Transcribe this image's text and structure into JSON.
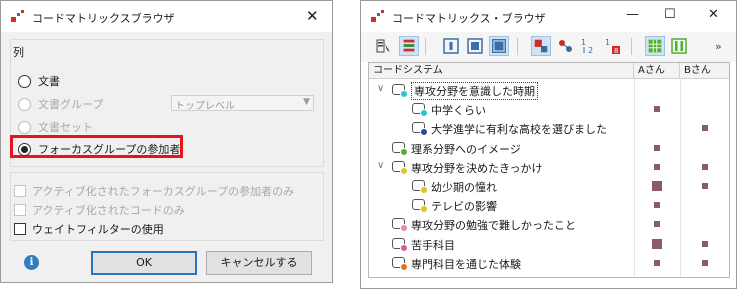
{
  "dialog": {
    "title": "コードマトリックスブラウザ",
    "close_glyph": "✕",
    "group_label": "列",
    "radios": [
      {
        "label": "文書",
        "selected": false,
        "enabled": true
      },
      {
        "label": "文書グループ",
        "selected": false,
        "enabled": false
      },
      {
        "label": "文書セット",
        "selected": false,
        "enabled": false
      },
      {
        "label": "フォーカスグループの参加者",
        "selected": true,
        "enabled": true
      }
    ],
    "group_combo_value": "トップレベル",
    "checkboxes": [
      {
        "label": "アクティブ化されたフォーカスグループの参加者のみ",
        "checked": false,
        "enabled": false
      },
      {
        "label": "アクティブ化されたコードのみ",
        "checked": false,
        "enabled": false
      },
      {
        "label": "ウェイトフィルターの使用",
        "checked": false,
        "enabled": true
      }
    ],
    "info_glyph": "i",
    "ok_label": "OK",
    "cancel_label": "キャンセルする",
    "highlight_color": "#e8141a"
  },
  "browser": {
    "title": "コードマトリックス・ブラウザ",
    "window_controls": {
      "minimize": "—",
      "maximize": "☐",
      "close": "✕"
    },
    "toolbar_more": "»",
    "toolbar_icons": [
      "code-list-icon",
      "doc-list-icon",
      "column-view-icon",
      "square-view-icon",
      "filled-square-icon",
      "node-icon",
      "node-link-icon",
      "sort-one-two-icon",
      "sort-one-eight-icon",
      "grid-icon",
      "columns-icon"
    ],
    "columns": [
      "コードシステム",
      "Aさん",
      "Bさん"
    ],
    "rows": [
      {
        "label": "専攻分野を意識した時期",
        "level": 0,
        "expander": "∨",
        "color": "#2ac4d6",
        "focused": true,
        "a": 0,
        "b": 0
      },
      {
        "label": "中学くらい",
        "level": 1,
        "expander": "",
        "color": "#2ac4d6",
        "focused": false,
        "a": 1,
        "b": 0
      },
      {
        "label": "大学進学に有利な高校を選びました",
        "level": 1,
        "expander": "",
        "color": "#1e4ea0",
        "focused": false,
        "a": 0,
        "b": 1
      },
      {
        "label": "理系分野へのイメージ",
        "level": 0,
        "expander": "",
        "color": "#4eb030",
        "focused": false,
        "a": 1,
        "b": 0
      },
      {
        "label": "専攻分野を決めたきっかけ",
        "level": 0,
        "expander": "∨",
        "color": "#e0c51c",
        "focused": false,
        "a": 1,
        "b": 1
      },
      {
        "label": "幼少期の憧れ",
        "level": 1,
        "expander": "",
        "color": "#e0c51c",
        "focused": false,
        "a": 2,
        "b": 1
      },
      {
        "label": "テレビの影響",
        "level": 1,
        "expander": "",
        "color": "#e0c51c",
        "focused": false,
        "a": 1,
        "b": 0
      },
      {
        "label": "専攻分野の勉強で難しかったこと",
        "level": 0,
        "expander": "",
        "color": "#e889b4",
        "focused": false,
        "a": 1,
        "b": 0
      },
      {
        "label": "苦手科目",
        "level": 0,
        "expander": "",
        "color": "#e0579c",
        "focused": false,
        "a": 2,
        "b": 1
      },
      {
        "label": "専門科目を通じた体験",
        "level": 0,
        "expander": "",
        "color": "#e8711e",
        "focused": false,
        "a": 1,
        "b": 1
      }
    ],
    "cell_color": "#8c5a70"
  }
}
